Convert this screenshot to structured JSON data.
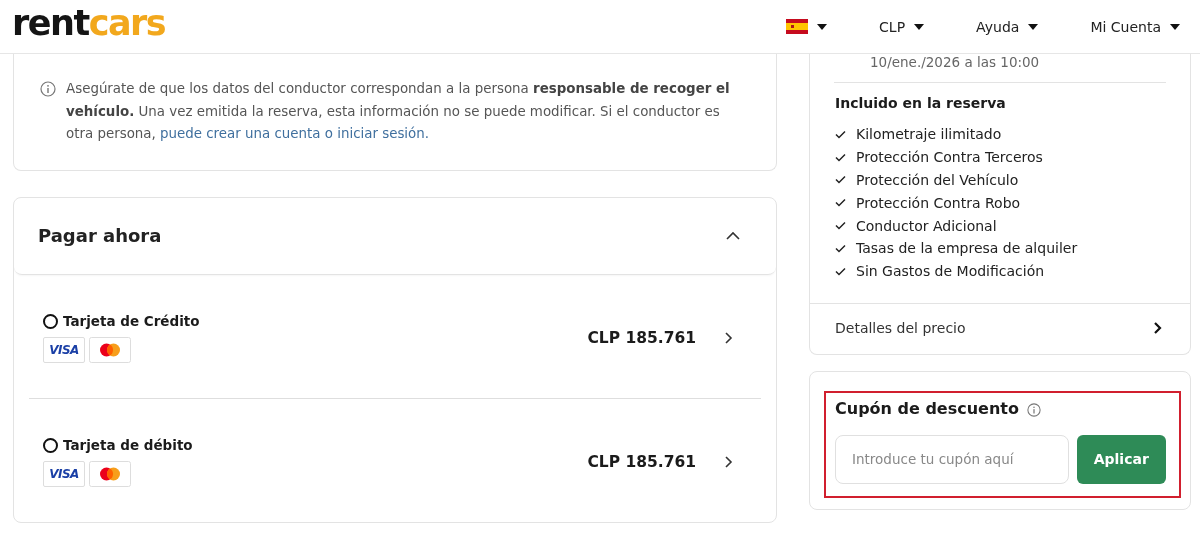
{
  "header": {
    "logo": {
      "dark": "rent",
      "accent": "cars"
    },
    "menus": [
      {
        "kind": "flag"
      },
      {
        "kind": "text",
        "label": "CLP"
      },
      {
        "kind": "text",
        "label": "Ayuda"
      },
      {
        "kind": "text",
        "label": "Mi Cuenta"
      }
    ]
  },
  "driver_notice": {
    "text": "Asegúrate de que los datos del conductor correspondan a la persona **responsable de recoger el vehículo.** Una vez emitida la reserva, esta información no se puede modificar. Si el conductor es otra persona,",
    "link": "puede crear una cuenta o iniciar sesión."
  },
  "payment": {
    "title": "Pagar ahora",
    "expanded": true,
    "options": [
      {
        "label": "Tarjeta de Crédito",
        "selected": false,
        "price": "CLP 185.761",
        "cards": [
          {
            "kind": "visa",
            "text": "VISA"
          },
          {
            "kind": "mastercard"
          }
        ]
      },
      {
        "label": "Tarjeta de débito",
        "selected": false,
        "price": "CLP 185.761",
        "cards": [
          {
            "kind": "visa",
            "text": "VISA"
          },
          {
            "kind": "mastercard"
          }
        ]
      }
    ]
  },
  "summary": {
    "return_date": "10/ene./2026 a las 10:00",
    "included_title": "Incluido en la reserva",
    "included": [
      "Kilometraje ilimitado",
      "Protección Contra Terceros",
      "Protección del Vehículo",
      "Protección Contra Robo",
      "Conductor Adicional",
      "Tasas de la empresa de alquiler",
      "Sin Gastos de Modificación"
    ],
    "price_details": "Detalles del precio"
  },
  "coupon": {
    "title": "Cupón de descuento",
    "placeholder": "Introduce tu cupón aquí",
    "button": "Aplicar"
  }
}
